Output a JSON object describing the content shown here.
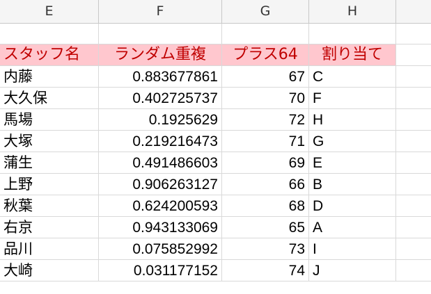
{
  "columns": [
    "E",
    "F",
    "G",
    "H"
  ],
  "header": {
    "staff": "スタッフ名",
    "random": "ランダム重複",
    "plus": "プラス64",
    "assign": "割り当て"
  },
  "rows": [
    {
      "name": "内藤",
      "rand": "0.883677861",
      "plus": "67",
      "assign": "C"
    },
    {
      "name": "大久保",
      "rand": "0.402725737",
      "plus": "70",
      "assign": "F"
    },
    {
      "name": "馬場",
      "rand": "0.1925629",
      "plus": "72",
      "assign": "H"
    },
    {
      "name": "大塚",
      "rand": "0.219216473",
      "plus": "71",
      "assign": "G"
    },
    {
      "name": "蒲生",
      "rand": "0.491486603",
      "plus": "69",
      "assign": "E"
    },
    {
      "name": "上野",
      "rand": "0.906263127",
      "plus": "66",
      "assign": "B"
    },
    {
      "name": "秋葉",
      "rand": "0.624200593",
      "plus": "68",
      "assign": "D"
    },
    {
      "name": "右京",
      "rand": "0.943133069",
      "plus": "65",
      "assign": "A"
    },
    {
      "name": "品川",
      "rand": "0.075852992",
      "plus": "73",
      "assign": "I"
    },
    {
      "name": "大崎",
      "rand": "0.031177152",
      "plus": "74",
      "assign": "J"
    }
  ],
  "colors": {
    "header_fill": "#ffc7ce",
    "header_text": "#c00000",
    "grid_line": "#d9d9d9"
  }
}
